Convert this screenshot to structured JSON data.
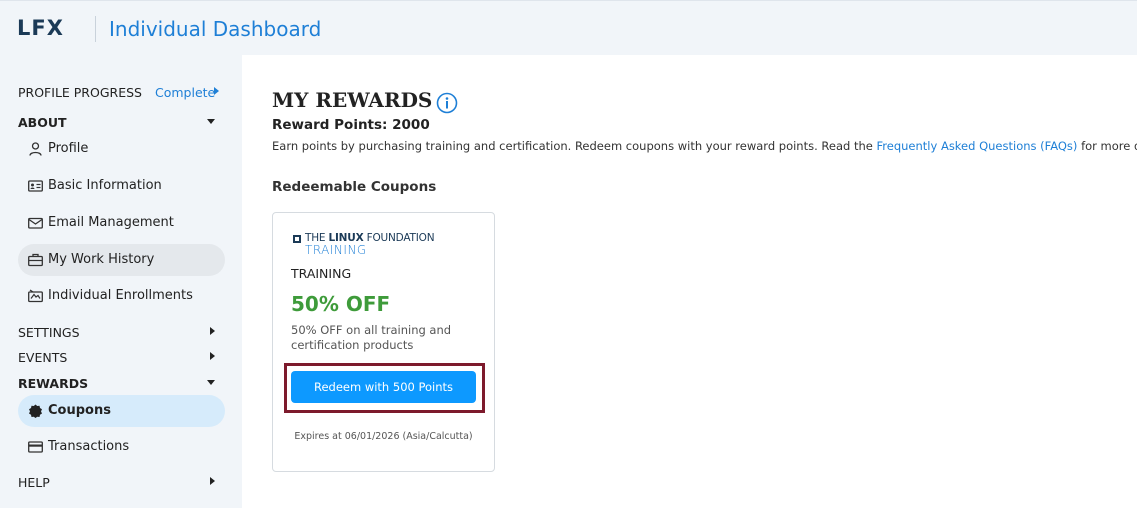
{
  "header": {
    "logo": "LFX",
    "title": "Individual Dashboard"
  },
  "sidebar": {
    "profile_progress": {
      "label": "PROFILE PROGRESS",
      "status": "Complete"
    },
    "about": {
      "label": "ABOUT",
      "items": [
        {
          "label": "Profile",
          "icon": "user-icon"
        },
        {
          "label": "Basic Information",
          "icon": "id-card-icon"
        },
        {
          "label": "Email Management",
          "icon": "envelope-icon"
        },
        {
          "label": "My Work History",
          "icon": "briefcase-icon"
        },
        {
          "label": "Individual Enrollments",
          "icon": "enrollment-icon"
        }
      ]
    },
    "settings": {
      "label": "SETTINGS"
    },
    "events": {
      "label": "EVENTS"
    },
    "rewards": {
      "label": "REWARDS",
      "items": [
        {
          "label": "Coupons",
          "icon": "badge-icon"
        },
        {
          "label": "Transactions",
          "icon": "card-icon"
        }
      ]
    },
    "help": {
      "label": "HELP"
    }
  },
  "main": {
    "title": "MY REWARDS",
    "reward_points": "Reward Points: 2000",
    "description_prefix": "Earn points by purchasing training and certification. Redeem coupons with your reward points. Read the ",
    "faq_link": "Frequently Asked Questions (FAQs)",
    "description_suffix": " for more details.",
    "section_title": "Redeemable Coupons",
    "coupon": {
      "brand_line1_prefix": "THE ",
      "brand_line1_bold": "LINUX",
      "brand_line1_suffix": " FOUNDATION",
      "brand_line2": "TRAINING",
      "category": "TRAINING",
      "headline": "50% OFF",
      "description": "50% OFF on all training and certification products",
      "button_label": "Redeem with 500 Points",
      "expires": "Expires at 06/01/2026 (Asia/Calcutta)"
    }
  },
  "colors": {
    "accent": "#1e7fd6",
    "button": "#0d99ff",
    "discount": "#3e9b3a",
    "highlight": "#7d1a2c",
    "sidebar_bg": "#f1f5f9"
  }
}
